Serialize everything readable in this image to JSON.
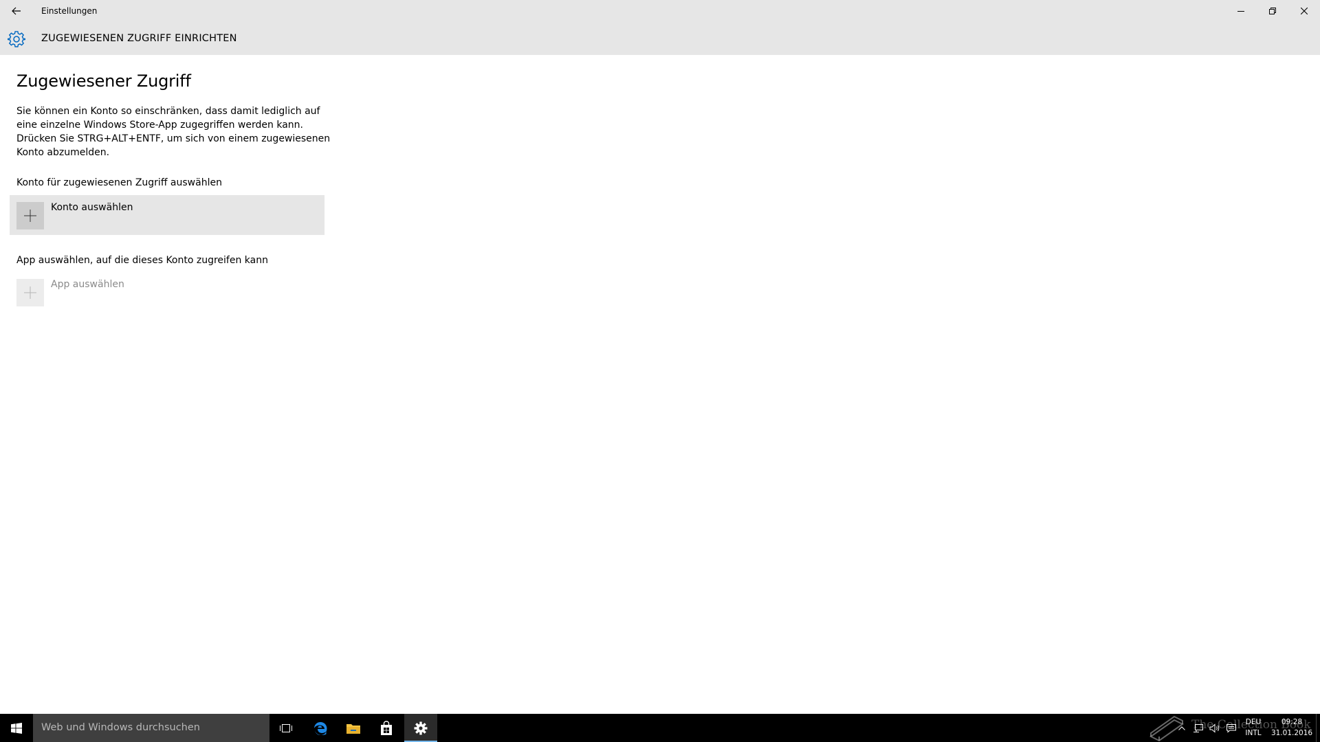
{
  "window": {
    "title": "Einstellungen"
  },
  "header": {
    "title": "ZUGEWIESENEN ZUGRIFF EINRICHTEN",
    "icon": "gear-icon",
    "accent_color": "#0067c0"
  },
  "page": {
    "title": "Zugewiesener Zugriff",
    "description": "Sie können ein Konto so einschränken, dass damit lediglich auf eine einzelne Windows Store-App zugegriffen werden kann. Drücken Sie STRG+ALT+ENTF, um sich von einem zugewiesenen Konto abzumelden.",
    "account_section_label": "Konto für zugewiesenen Zugriff auswählen",
    "account_picker_label": "Konto auswählen",
    "app_section_label": "App auswählen, auf die dieses Konto zugreifen kann",
    "app_picker_label": "App auswählen"
  },
  "taskbar": {
    "search_placeholder": "Web und Windows durchsuchen",
    "apps": [
      "task-view-icon",
      "edge-icon",
      "file-explorer-icon",
      "store-icon",
      "settings-icon"
    ],
    "language_line1": "DEU",
    "language_line2": "INTL",
    "time": "09:28",
    "date": "31.01.2016",
    "watermark": "The Collection Book"
  }
}
